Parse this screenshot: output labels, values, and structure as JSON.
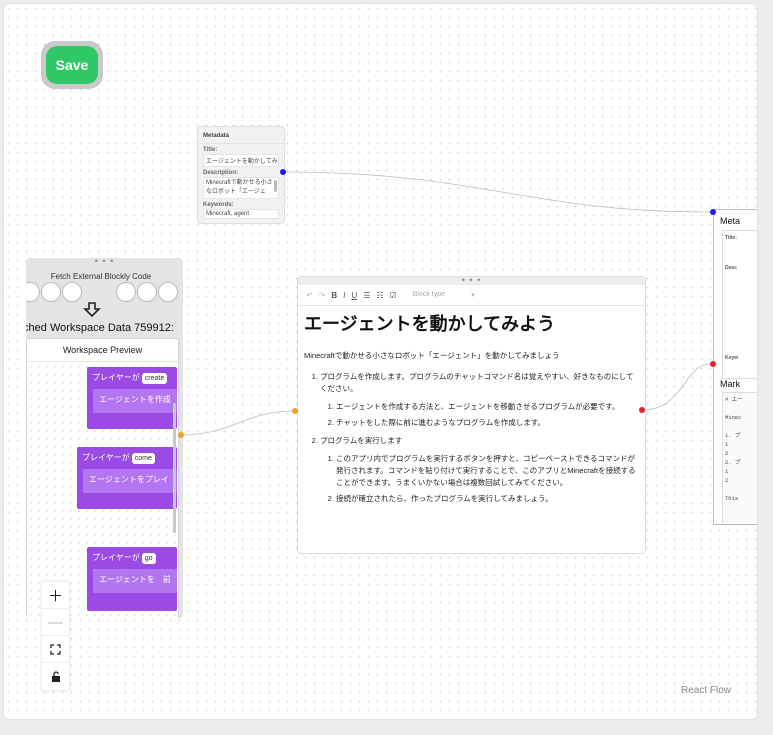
{
  "app": {
    "save_label": "Save",
    "credit": "React Flow"
  },
  "metadata_node": {
    "header": "Metadata",
    "title_label": "Title:",
    "title_value": "エージェントを動かしてみよ",
    "description_label": "Description:",
    "description_value": "Minecraftで動かせる小さなロボット「エージェ",
    "keywords_label": "Keywords:",
    "keywords_value": "Minecraft, agent"
  },
  "fetch_node": {
    "title": "Fetch External Blockly Code",
    "workspace_data": "tched Workspace Data 759912:",
    "workspace_preview": "Workspace Preview",
    "blocks": [
      {
        "event": "プレイヤーが",
        "command": "create",
        "action": "エージェントを作成"
      },
      {
        "event": "プレイヤーが",
        "command": "come",
        "action": "エージェントをプレイ"
      },
      {
        "event": "プレイヤーが",
        "command": "go",
        "action": "エージェントを　前"
      }
    ]
  },
  "editor_node": {
    "block_type": "Block type",
    "heading": "エージェントを動かしてみよう",
    "intro": "Minecraftで動かせる小さなロボット「エージェント」を動かしてみましょう",
    "items": [
      {
        "text": "プログラムを作成します。プログラムのチャットコマンド名は覚えやすい、好きなものにしてください。",
        "sub": [
          "エージェントを作成する方法と、エージェントを移動させるプログラムが必要です。",
          "チャットをした際に前に進むようなプログラムを作成します。"
        ]
      },
      {
        "text": "プログラムを実行します",
        "sub": [
          "このアプリ内でプログラムを実行するボタンを押すと、コピーペーストできるコマンドが発行されます。コマンドを貼り付けて実行することで、このアプリとMinecraftを接続することができます。うまくいかない場合は複数回試してみてください。",
          "接続が確立されたら、作ったプログラムを実行してみましょう。"
        ]
      }
    ]
  },
  "right_node": {
    "title": "Meta",
    "title_label": "Title:",
    "description_label": "Desc",
    "keywords_label": "Keyw",
    "markdown_label": "Mark",
    "markdown_lines": [
      "# エー",
      "",
      "Minec",
      "",
      "1. プ",
      "   1",
      "   2",
      "2. プ",
      "   1",
      "   2",
      "",
      "This"
    ]
  },
  "colors": {
    "save": "#2ec866",
    "block": "#9b4ae6",
    "handle_source": "#1b1bf0",
    "handle_orange": "#f0a020",
    "handle_red": "#e8202a"
  }
}
